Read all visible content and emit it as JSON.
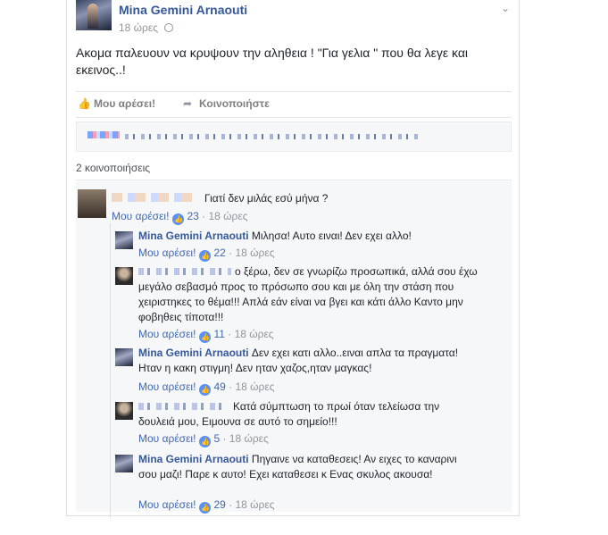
{
  "post": {
    "author": "Mina Gemini Arnaouti",
    "time": "18 ώρες",
    "text": "Ακομα παλευουν να κρυψουν την αληθεια ! \"Για γελια \" που θα λεγε και εκεινος..!"
  },
  "actions": {
    "like": "Μου αρέσει!",
    "share": "Κοινοποιήστε"
  },
  "shares_count": "2 κοινοποιήσεις",
  "comments": [
    {
      "author": "",
      "text": "Γιατί δεν μιλάς εσύ μήνα ?",
      "like": "Μου αρέσει!",
      "likes": "23",
      "time": "18 ώρες"
    },
    {
      "author": "Mina Gemini Arnaouti",
      "text": "Μιλησα! Αυτο ειναι! Δεν εχει αλλο!",
      "like": "Μου αρέσει!",
      "likes": "22",
      "time": "18 ώρες"
    },
    {
      "author": "",
      "text": "ο ξέρω, δεν σε γνωρίζω προσωπικά, αλλά σου έχω μεγάλο σεβασμό προς το πρόσωπο σου και με όλη την στάση που χειριστηκες το θέμα!!! Απλά εάν είναι να βγει και κάτι άλλο Καντο μην φοβηθεις τίποτα!!!",
      "like": "Μου αρέσει!",
      "likes": "11",
      "time": "18 ώρες"
    },
    {
      "author": "Mina Gemini Arnaouti",
      "text": "Δεν εχει κατι αλλο..ειναι απλα τα πραγματα! Ηταν η κακη στιγμη! Δεν ηταν χαζος,ηταν μαγκας!",
      "like": "Μου αρέσει!",
      "likes": "49",
      "time": "18 ώρες"
    },
    {
      "author": "",
      "text": "Κατά σύμπτωση το πρωί όταν τελείωσα την δουλειά μου, Ειμουνα σε αυτό το σημείο!!!",
      "like": "Μου αρέσει!",
      "likes": "5",
      "time": "18 ώρες"
    },
    {
      "author": "Mina Gemini Arnaouti",
      "text": "Πηγαινε να καταθεσεις! Αν ειχες το καναρινι σου μαζι! Παρε κ αυτο! Εχει καταθεσει κ Ενας σκυλος ακουσα!",
      "like": "Μου αρέσει!",
      "likes": "29",
      "time": "18 ώρες"
    }
  ],
  "icons": {
    "like": "thumbs-up-icon",
    "share": "share-arrow-icon",
    "reaction": "like-reaction-icon",
    "menu": "chevron-down-icon"
  },
  "colors": {
    "link": "#365899",
    "like_blue": "#5890ff",
    "meta_gray": "#90949c"
  }
}
